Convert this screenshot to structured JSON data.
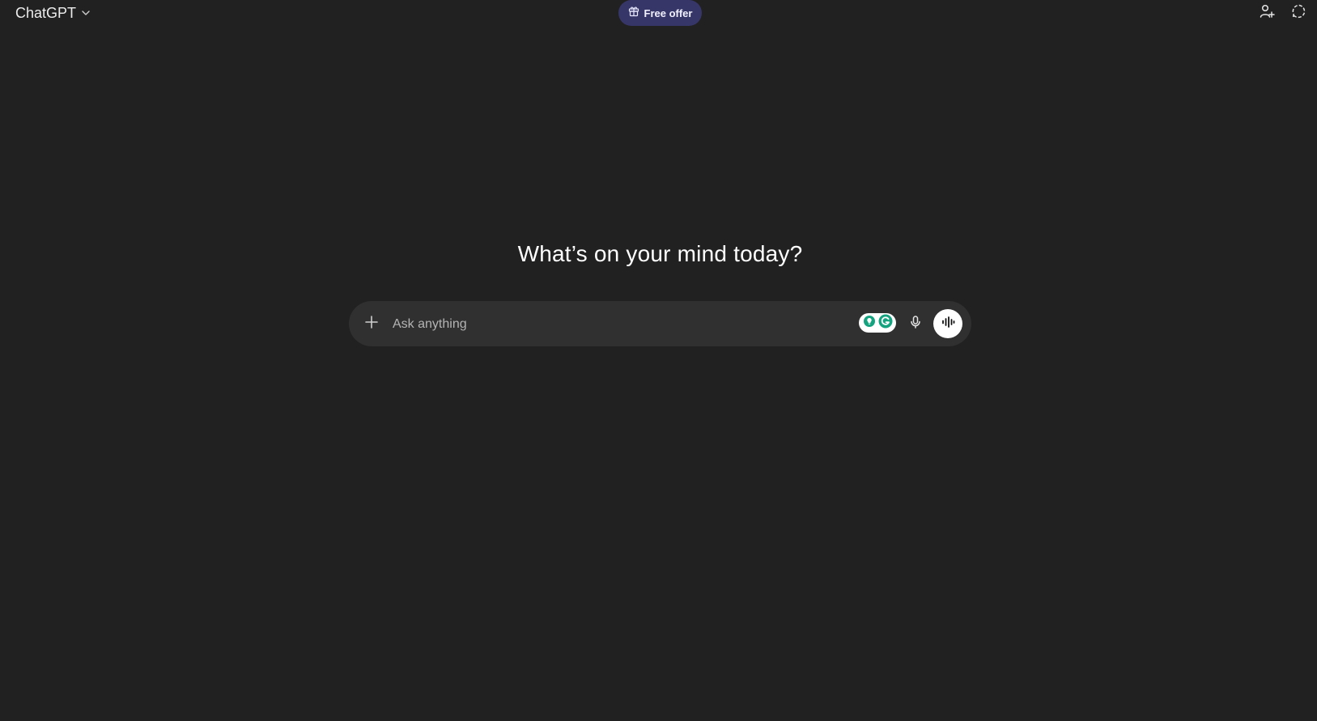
{
  "header": {
    "model_label": "ChatGPT",
    "offer_label": "Free offer"
  },
  "icons": {
    "model_chevron": "chevron-down-icon",
    "offer": "gift-icon",
    "share": "add-user-icon",
    "temporary_chat": "dashed-chat-bubble-icon",
    "plus": "plus-icon",
    "extension": "grammarly-icon",
    "mic": "microphone-icon",
    "voice": "voice-waveform-icon"
  },
  "main": {
    "headline": "What’s on your mind today?"
  },
  "composer": {
    "placeholder": "Ask anything",
    "value": ""
  },
  "colors": {
    "background": "#212121",
    "composer": "#303030",
    "offer_pill": "#373669",
    "extension_accent": "#15a37f"
  }
}
